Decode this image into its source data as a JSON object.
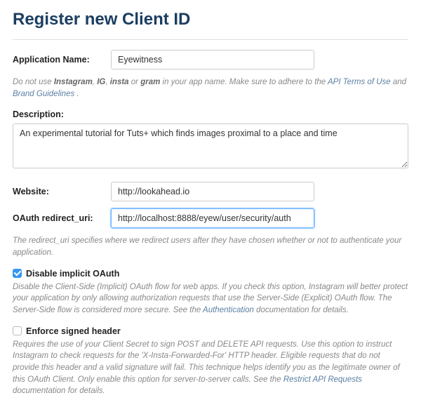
{
  "title": "Register new Client ID",
  "fields": {
    "app_name_label": "Application Name:",
    "app_name_value": "Eyewitness",
    "app_name_hint_prefix": "Do not use ",
    "app_name_hint_b1": "Instagram",
    "app_name_hint_sep": ", ",
    "app_name_hint_b2": "IG",
    "app_name_hint_b3": "insta",
    "app_name_hint_or": " or ",
    "app_name_hint_b4": "gram",
    "app_name_hint_mid": " in your app name. Make sure to adhere to the ",
    "app_name_hint_link1": "API Terms of Use",
    "app_name_hint_and": " and ",
    "app_name_hint_link2": "Brand Guidelines",
    "app_name_hint_end": " .",
    "description_label": "Description:",
    "description_value": "An experimental tutorial for Tuts+ which finds images proximal to a place and time",
    "website_label": "Website:",
    "website_value": "http://lookahead.io",
    "redirect_label": "OAuth redirect_uri:",
    "redirect_value": "http://localhost:8888/eyew/user/security/auth",
    "redirect_hint": "The redirect_uri specifies where we redirect users after they have chosen whether or not to authenticate your application."
  },
  "options": {
    "implicit_label": "Disable implicit OAuth",
    "implicit_hint_pre": "Disable the Client-Side (Implicit) OAuth flow for web apps. If you check this option, Instagram will better protect your application by only allowing authorization requests that use the Server-Side (Explicit) OAuth flow. The Server-Side flow is considered more secure. See the ",
    "implicit_hint_link": "Authentication",
    "implicit_hint_post": " documentation for details.",
    "signed_label": "Enforce signed header",
    "signed_hint_pre": "Requires the use of your Client Secret to sign POST and DELETE API requests. Use this option to instruct Instagram to check requests for the 'X-Insta-Forwarded-For' HTTP header. Eligible requests that do not provide this header and a valid signature will fail. This technique helps identify you as the legitimate owner of this OAuth Client. Only enable this option for server-to-server calls. See the ",
    "signed_hint_link": "Restrict API Requests",
    "signed_hint_post": " documentation for details."
  }
}
